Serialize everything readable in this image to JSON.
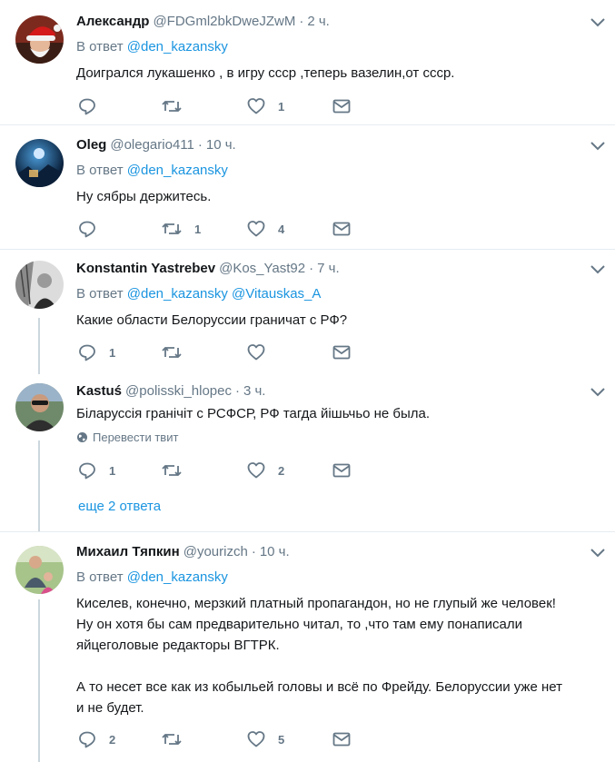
{
  "tweets": [
    {
      "fullname": "Александр",
      "username": "@FDGml2bkDweJZwM",
      "time": "2 ч.",
      "reply_prefix": "В ответ",
      "mentions": [
        "@den_kazansky"
      ],
      "text": [
        "Доигрался лукашенко , в игру ссср ,теперь вазелин,от ссср."
      ],
      "replies": "",
      "retweets": "",
      "likes": "1"
    },
    {
      "fullname": "Oleg",
      "username": "@olegario411",
      "time": "10 ч.",
      "reply_prefix": "В ответ",
      "mentions": [
        "@den_kazansky"
      ],
      "text": [
        "Ну сябры держитесь."
      ],
      "replies": "",
      "retweets": "1",
      "likes": "4"
    },
    {
      "fullname": "Konstantin Yastrebev",
      "username": "@Kos_Yast92",
      "time": "7 ч.",
      "reply_prefix": "В ответ",
      "mentions": [
        "@den_kazansky",
        "@Vitauskas_A"
      ],
      "text": [
        "Какие области Белоруссии граничат с РФ?"
      ],
      "replies": "1",
      "retweets": "",
      "likes": ""
    },
    {
      "fullname": "Kastuś",
      "username": "@polisski_hlopec",
      "time": "3 ч.",
      "text": [
        "Біларуссія гранічіт с РСФСР, РФ тагда йішьчьо не была."
      ],
      "translate_label": "Перевести твит",
      "replies": "1",
      "retweets": "",
      "likes": "2"
    },
    {
      "fullname": "Михаил Тяпкин",
      "username": "@yourizch",
      "time": "10 ч.",
      "reply_prefix": "В ответ",
      "mentions": [
        "@den_kazansky"
      ],
      "text": [
        "Киселев, конечно, мерзкий платный пропагандон, но не глупый же человек!",
        "Ну он хотя бы сам предварительно читал, то ,что там ему понаписали",
        "яйцеголовые редакторы ВГТРК.",
        "",
        "А то несет все как из кобыльей головы и всё по Фрейду. Белоруссии уже нет",
        "и не будет."
      ],
      "replies": "2",
      "retweets": "",
      "likes": "5"
    }
  ],
  "more_replies_label": "еще 2 ответа",
  "colors": {
    "link": "#1b95e0",
    "muted": "#657786",
    "text": "#14171a",
    "divider": "#e6ecf0",
    "thread_line": "#ccd6dd"
  },
  "icons": {
    "reply": "reply-icon",
    "retweet": "retweet-icon",
    "like": "heart-icon",
    "dm": "envelope-icon",
    "more": "chevron-down-icon",
    "translate": "globe-icon"
  }
}
